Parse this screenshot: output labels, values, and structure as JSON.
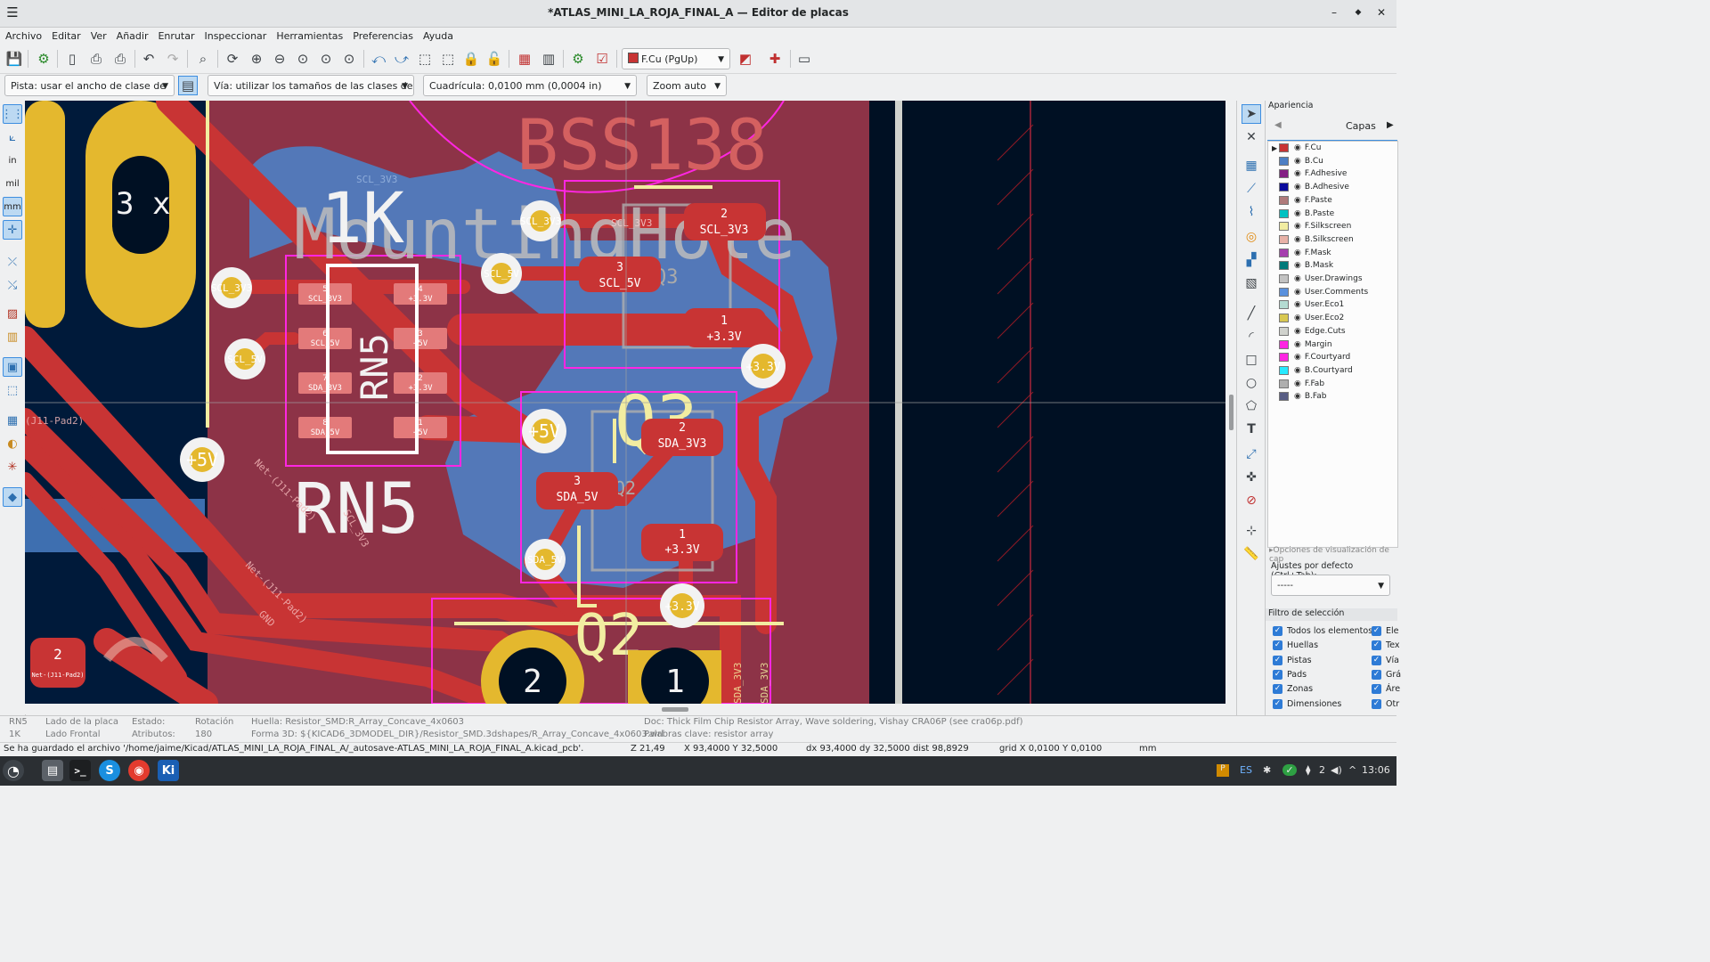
{
  "window": {
    "title": "*ATLAS_MINI_LA_ROJA_FINAL_A — Editor de placas"
  },
  "menu": [
    "Archivo",
    "Editar",
    "Ver",
    "Añadir",
    "Enrutar",
    "Inspeccionar",
    "Herramientas",
    "Preferencias",
    "Ayuda"
  ],
  "toolbar": {
    "layer_select": "F.Cu (PgUp)"
  },
  "toolbar2": {
    "track_width": "Pista: usar el ancho de clase de red",
    "via_size": "Vía: utilizar los tamaños de las clases de red",
    "grid": "Cuadrícula: 0,0100 mm (0,0004 in)",
    "zoom": "Zoom auto"
  },
  "left_toolbar": {
    "in": "in",
    "mil": "mil",
    "mm": "mm"
  },
  "canvas": {
    "silk_large": {
      "bss138": "BSS138",
      "onek": "1K",
      "rn5": "RN5",
      "q3": "Q3",
      "q2": "Q2",
      "mounting": "MountingHole",
      "three_x": "3 x"
    },
    "pads": {
      "p_scl3v3_top": "SCL_3V3",
      "p_scl5v": "SCL_5V",
      "p_scl3v3_left": "SCL_3V3",
      "p_scl5v_left": "SCL_5V",
      "p_5v_center": "+5V",
      "p_5v_left": "+5V",
      "p_3v3_right": "+3.3V",
      "p_sda5v": "SDA_5V",
      "p_3v3_bottom": "+3.3V",
      "q3_2_num": "2",
      "q3_2_net": "SCL_3V3",
      "q3_3_num": "3",
      "q3_3_net": "SCL_5V",
      "q3_1_num": "1",
      "q3_1_net": "+3.3V",
      "q2_2_num": "2",
      "q2_2_net": "SDA_3V3",
      "q2_3_num": "3",
      "q2_3_net": "SDA_5V",
      "q2_1_num": "1",
      "q2_1_net": "+3.3V",
      "big2": "2",
      "big1": "1",
      "j11_num": "2",
      "j11_net": "Net-(J11-Pad2)",
      "j11_label": "(J11-Pad2)",
      "rn_5": "5",
      "rn_5n": "SCL_3V3",
      "rn_4": "4",
      "rn_4n": "+3.3V",
      "rn_6": "6",
      "rn_6n": "SCL_5V",
      "rn_3": "3",
      "rn_3n": "+5V",
      "rn_7": "7",
      "rn_7n": "SDA_3V3",
      "rn_2": "2",
      "rn_2n": "+3.3V",
      "rn_8": "8",
      "rn_8n": "SDA_5V",
      "rn_1": "1",
      "rn_1n": "+5V",
      "net_j11_a": "Net-(J11-Pad2)",
      "net_j11_b": "Net-(J11-Pad2)",
      "net_scl": "SCL_3V3",
      "net_gnd": "GND",
      "net_scl3v3_diag": "SCL_3V3",
      "net_sda3v3": "SDA_3V3"
    }
  },
  "appearance": {
    "title": "Apariencia",
    "tab": "Capas",
    "layers": [
      {
        "name": "F.Cu",
        "color": "#c83434"
      },
      {
        "name": "B.Cu",
        "color": "#4d7fc4"
      },
      {
        "name": "F.Adhesive",
        "color": "#841f84"
      },
      {
        "name": "B.Adhesive",
        "color": "#0a0a9c"
      },
      {
        "name": "F.Paste",
        "color": "#b07a7a"
      },
      {
        "name": "B.Paste",
        "color": "#00c2c2"
      },
      {
        "name": "F.Silkscreen",
        "color": "#f2eda1"
      },
      {
        "name": "B.Silkscreen",
        "color": "#e8b2a7"
      },
      {
        "name": "F.Mask",
        "color": "#a53eae"
      },
      {
        "name": "B.Mask",
        "color": "#027a7a"
      },
      {
        "name": "User.Drawings",
        "color": "#c2c2c2"
      },
      {
        "name": "User.Comments",
        "color": "#5990dd"
      },
      {
        "name": "User.Eco1",
        "color": "#b4dbd2"
      },
      {
        "name": "User.Eco2",
        "color": "#d8c852"
      },
      {
        "name": "Edge.Cuts",
        "color": "#d0d2cd"
      },
      {
        "name": "Margin",
        "color": "#ff26e2"
      },
      {
        "name": "F.Courtyard",
        "color": "#ff26e2"
      },
      {
        "name": "B.Courtyard",
        "color": "#26e9ff"
      },
      {
        "name": "F.Fab",
        "color": "#afafaf"
      },
      {
        "name": "B.Fab",
        "color": "#585d84"
      }
    ],
    "viz_options": "Opciones de visualización de cap",
    "presets_label": "Ajustes por defecto (Ctrl+Tab):",
    "presets_value": "-----",
    "filter_title": "Filtro de selección",
    "filter_left": [
      "Todos los elementos",
      "Huellas",
      "Pistas",
      "Pads",
      "Zonas",
      "Dimensiones"
    ],
    "filter_right": [
      "Ele",
      "Tex",
      "Vía",
      "Grá",
      "Áre",
      "Otr"
    ]
  },
  "msgpanel": {
    "ref": "RN5",
    "val": "1K",
    "side_h": "Lado de la placa",
    "side_v": "Lado Frontal",
    "state_h": "Estado:",
    "attr_h": "Atributos:",
    "rot_h": "Rotación",
    "rot_v": "180",
    "footprint": "Huella: Resistor_SMD:R_Array_Concave_4x0603",
    "model3d": "Forma 3D: ${KICAD6_3DMODEL_DIR}/Resistor_SMD.3dshapes/R_Array_Concave_4x0603.wrl",
    "doc": "Doc: Thick Film Chip Resistor Array, Wave soldering, Vishay CRA06P (see cra06p.pdf)",
    "keywords": "Palabras clave: resistor array"
  },
  "statusbar": {
    "message": "Se ha guardado el archivo '/home/jaime/Kicad/ATLAS_MINI_LA_ROJA_FINAL_A/_autosave-ATLAS_MINI_LA_ROJA_FINAL_A.kicad_pcb'.",
    "z": "Z 21,49",
    "xy": "X 93,4000  Y 32,5000",
    "dxy": "dx 93,4000  dy 32,5000  dist 98,8929",
    "grid": "grid X 0,0100  Y 0,0100",
    "units": "mm"
  },
  "taskbar": {
    "lang": "ES",
    "badge": "2",
    "clock": "13:06"
  }
}
